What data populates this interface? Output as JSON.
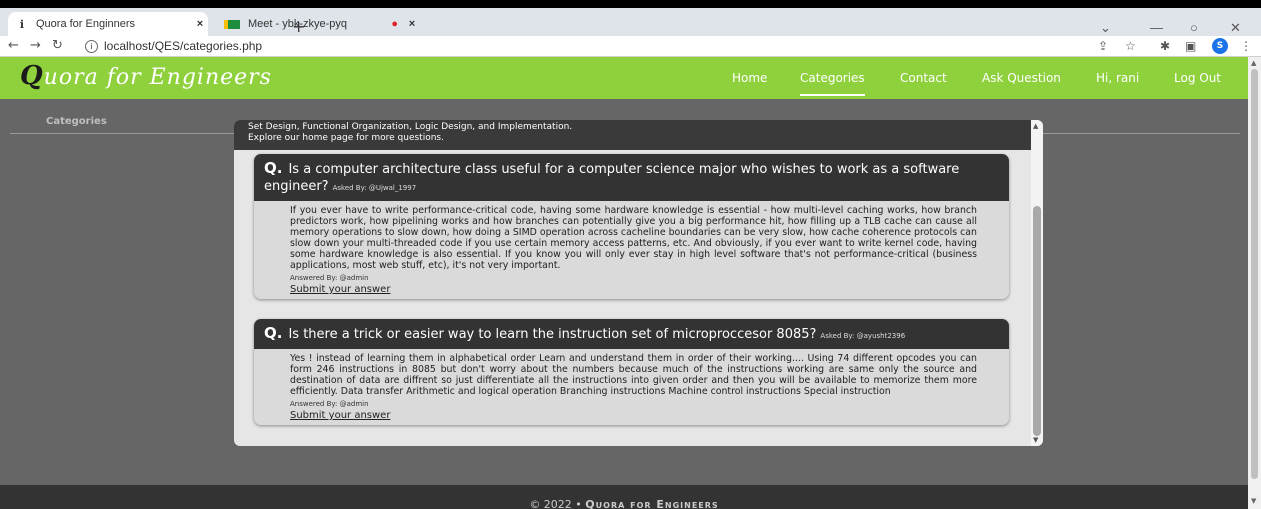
{
  "browser": {
    "tabs": [
      {
        "title": "Quora for Enginners",
        "close": "×"
      },
      {
        "title": "Meet - ybk-zkye-pyq",
        "close": "×"
      }
    ],
    "new_tab": "+",
    "url": "localhost/QES/categories.php",
    "profile_initial": "S"
  },
  "navbar": {
    "brand_initial": "Q",
    "brand_rest": "uora for Engineers",
    "links": [
      "Home",
      "Categories",
      "Contact",
      "Ask Question",
      "Hi, rani",
      "Log Out"
    ],
    "active": "Categories"
  },
  "page": {
    "categories_label": "Categories"
  },
  "modal": {
    "header_lines": [
      "Set Design, Functional Organization, Logic Design, and Implementation.",
      "Explore our home page for more questions."
    ],
    "questions": [
      {
        "question": "Is a computer architecture class useful for a computer science major who wishes to work as a software engineer?",
        "asked_by": "Asked By: @Ujwal_1997",
        "answer": "If you ever have to write performance-critical code, having some hardware knowledge is essential - how multi-level caching works, how branch predictors work, how pipelining works and how branches can potentially give you a big performance hit, how filling up a TLB cache can cause all memory operations to slow down, how doing a SIMD operation across cacheline boundaries can be very slow, how cache coherence protocols can slow down your multi-threaded code if you use certain memory access patterns, etc. And obviously, if you ever want to write kernel code, having some hardware knowledge is also essential. If you know you will only ever stay in high level software that's not performance-critical (business applications, most web stuff, etc), it's not very important.",
        "answered_by": "Answered By: @admin",
        "submit": "Submit your answer"
      },
      {
        "question": "Is there a trick or easier way to learn the instruction set of microproccesor 8085?",
        "asked_by": "Asked By: @ayusht2396",
        "answer": "Yes ! instead of learning them in alphabetical order Learn and understand them in order of their working.... Using 74 different opcodes you can form 246 instructions in 8085 but don't worry about the numbers because much of the instructions working are same only the source and destination of data are diffrent so just differentiate all the instructions into given order and then you will be available to memorize them more efficiently. Data transfer Arithmetic and logical operation Branching instructions Machine control instructions Special instruction",
        "answered_by": "Answered By: @admin",
        "submit": "Submit your answer"
      }
    ]
  },
  "footer": {
    "copyright": "© 2022 •",
    "brand": "Quora for Engineers"
  },
  "colors": {
    "navbar": "#8fd13c",
    "page_bg": "#666666",
    "card_header": "#333333"
  }
}
